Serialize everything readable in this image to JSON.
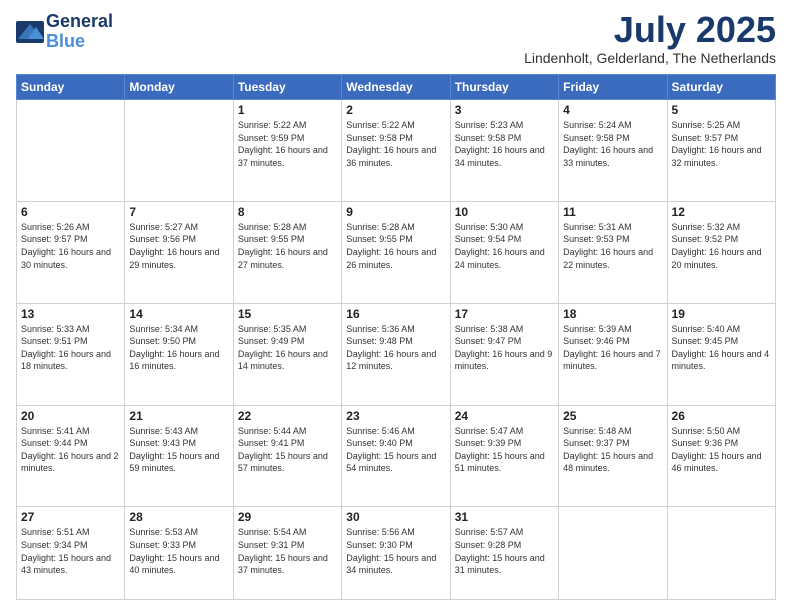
{
  "header": {
    "logo_line1": "General",
    "logo_line2": "Blue",
    "month": "July 2025",
    "location": "Lindenholt, Gelderland, The Netherlands"
  },
  "weekdays": [
    "Sunday",
    "Monday",
    "Tuesday",
    "Wednesday",
    "Thursday",
    "Friday",
    "Saturday"
  ],
  "weeks": [
    [
      {
        "day": "",
        "info": ""
      },
      {
        "day": "",
        "info": ""
      },
      {
        "day": "1",
        "info": "Sunrise: 5:22 AM\nSunset: 9:59 PM\nDaylight: 16 hours\nand 37 minutes."
      },
      {
        "day": "2",
        "info": "Sunrise: 5:22 AM\nSunset: 9:58 PM\nDaylight: 16 hours\nand 36 minutes."
      },
      {
        "day": "3",
        "info": "Sunrise: 5:23 AM\nSunset: 9:58 PM\nDaylight: 16 hours\nand 34 minutes."
      },
      {
        "day": "4",
        "info": "Sunrise: 5:24 AM\nSunset: 9:58 PM\nDaylight: 16 hours\nand 33 minutes."
      },
      {
        "day": "5",
        "info": "Sunrise: 5:25 AM\nSunset: 9:57 PM\nDaylight: 16 hours\nand 32 minutes."
      }
    ],
    [
      {
        "day": "6",
        "info": "Sunrise: 5:26 AM\nSunset: 9:57 PM\nDaylight: 16 hours\nand 30 minutes."
      },
      {
        "day": "7",
        "info": "Sunrise: 5:27 AM\nSunset: 9:56 PM\nDaylight: 16 hours\nand 29 minutes."
      },
      {
        "day": "8",
        "info": "Sunrise: 5:28 AM\nSunset: 9:55 PM\nDaylight: 16 hours\nand 27 minutes."
      },
      {
        "day": "9",
        "info": "Sunrise: 5:28 AM\nSunset: 9:55 PM\nDaylight: 16 hours\nand 26 minutes."
      },
      {
        "day": "10",
        "info": "Sunrise: 5:30 AM\nSunset: 9:54 PM\nDaylight: 16 hours\nand 24 minutes."
      },
      {
        "day": "11",
        "info": "Sunrise: 5:31 AM\nSunset: 9:53 PM\nDaylight: 16 hours\nand 22 minutes."
      },
      {
        "day": "12",
        "info": "Sunrise: 5:32 AM\nSunset: 9:52 PM\nDaylight: 16 hours\nand 20 minutes."
      }
    ],
    [
      {
        "day": "13",
        "info": "Sunrise: 5:33 AM\nSunset: 9:51 PM\nDaylight: 16 hours\nand 18 minutes."
      },
      {
        "day": "14",
        "info": "Sunrise: 5:34 AM\nSunset: 9:50 PM\nDaylight: 16 hours\nand 16 minutes."
      },
      {
        "day": "15",
        "info": "Sunrise: 5:35 AM\nSunset: 9:49 PM\nDaylight: 16 hours\nand 14 minutes."
      },
      {
        "day": "16",
        "info": "Sunrise: 5:36 AM\nSunset: 9:48 PM\nDaylight: 16 hours\nand 12 minutes."
      },
      {
        "day": "17",
        "info": "Sunrise: 5:38 AM\nSunset: 9:47 PM\nDaylight: 16 hours\nand 9 minutes."
      },
      {
        "day": "18",
        "info": "Sunrise: 5:39 AM\nSunset: 9:46 PM\nDaylight: 16 hours\nand 7 minutes."
      },
      {
        "day": "19",
        "info": "Sunrise: 5:40 AM\nSunset: 9:45 PM\nDaylight: 16 hours\nand 4 minutes."
      }
    ],
    [
      {
        "day": "20",
        "info": "Sunrise: 5:41 AM\nSunset: 9:44 PM\nDaylight: 16 hours\nand 2 minutes."
      },
      {
        "day": "21",
        "info": "Sunrise: 5:43 AM\nSunset: 9:43 PM\nDaylight: 15 hours\nand 59 minutes."
      },
      {
        "day": "22",
        "info": "Sunrise: 5:44 AM\nSunset: 9:41 PM\nDaylight: 15 hours\nand 57 minutes."
      },
      {
        "day": "23",
        "info": "Sunrise: 5:46 AM\nSunset: 9:40 PM\nDaylight: 15 hours\nand 54 minutes."
      },
      {
        "day": "24",
        "info": "Sunrise: 5:47 AM\nSunset: 9:39 PM\nDaylight: 15 hours\nand 51 minutes."
      },
      {
        "day": "25",
        "info": "Sunrise: 5:48 AM\nSunset: 9:37 PM\nDaylight: 15 hours\nand 48 minutes."
      },
      {
        "day": "26",
        "info": "Sunrise: 5:50 AM\nSunset: 9:36 PM\nDaylight: 15 hours\nand 46 minutes."
      }
    ],
    [
      {
        "day": "27",
        "info": "Sunrise: 5:51 AM\nSunset: 9:34 PM\nDaylight: 15 hours\nand 43 minutes."
      },
      {
        "day": "28",
        "info": "Sunrise: 5:53 AM\nSunset: 9:33 PM\nDaylight: 15 hours\nand 40 minutes."
      },
      {
        "day": "29",
        "info": "Sunrise: 5:54 AM\nSunset: 9:31 PM\nDaylight: 15 hours\nand 37 minutes."
      },
      {
        "day": "30",
        "info": "Sunrise: 5:56 AM\nSunset: 9:30 PM\nDaylight: 15 hours\nand 34 minutes."
      },
      {
        "day": "31",
        "info": "Sunrise: 5:57 AM\nSunset: 9:28 PM\nDaylight: 15 hours\nand 31 minutes."
      },
      {
        "day": "",
        "info": ""
      },
      {
        "day": "",
        "info": ""
      }
    ]
  ]
}
